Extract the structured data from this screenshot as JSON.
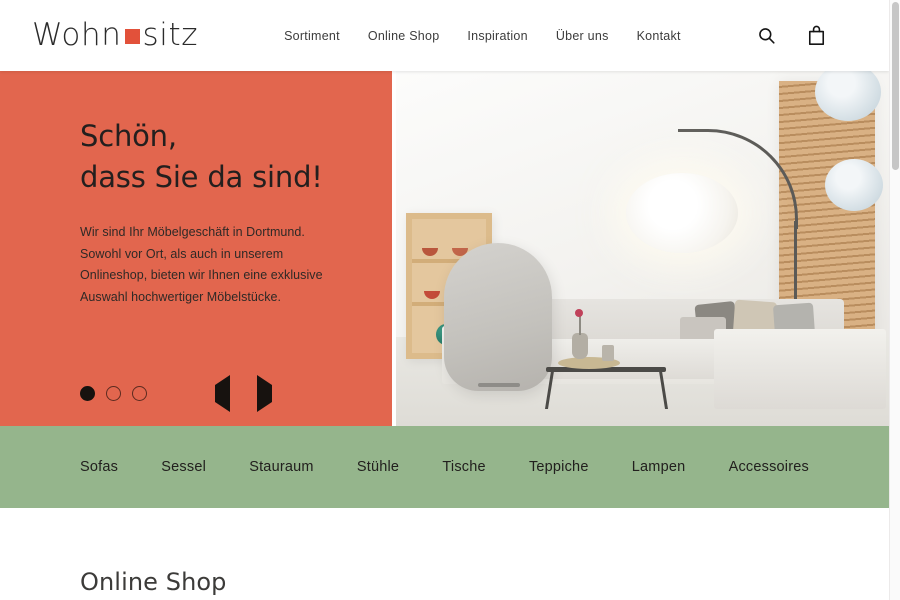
{
  "brand": {
    "name_part1": "Wohn",
    "name_part2": "sitz",
    "square_color": "#e2513a"
  },
  "header": {
    "nav": [
      {
        "label": "Sortiment"
      },
      {
        "label": "Online Shop"
      },
      {
        "label": "Inspiration"
      },
      {
        "label": "Über uns"
      },
      {
        "label": "Kontakt"
      }
    ],
    "icons": [
      {
        "name": "search-icon"
      },
      {
        "name": "shopping-bag-icon"
      }
    ]
  },
  "hero": {
    "background_color": "#e2664e",
    "title_line1": "Schön,",
    "title_line2": "dass Sie da sind!",
    "paragraph": "Wir sind Ihr Möbelgeschäft in Dortmund. Sowohl vor Ort, als auch in unserem Onlineshop, bieten wir Ihnen eine exklusive Auswahl hochwertiger Möbelstücke.",
    "carousel": {
      "slides": 3,
      "active_index": 0,
      "prev_label": "◀",
      "next_label": "▶"
    },
    "image_alt": "Wohnzimmer mit hellgrauem Ecksofa, Sessel, Couchtisch und Bogenlampe"
  },
  "categories": {
    "background_color": "#95b58c",
    "items": [
      {
        "label": "Sofas"
      },
      {
        "label": "Sessel"
      },
      {
        "label": "Stauraum"
      },
      {
        "label": "Stühle"
      },
      {
        "label": "Tische"
      },
      {
        "label": "Teppiche"
      },
      {
        "label": "Lampen"
      },
      {
        "label": "Accessoires"
      }
    ]
  },
  "section": {
    "title": "Online Shop"
  }
}
